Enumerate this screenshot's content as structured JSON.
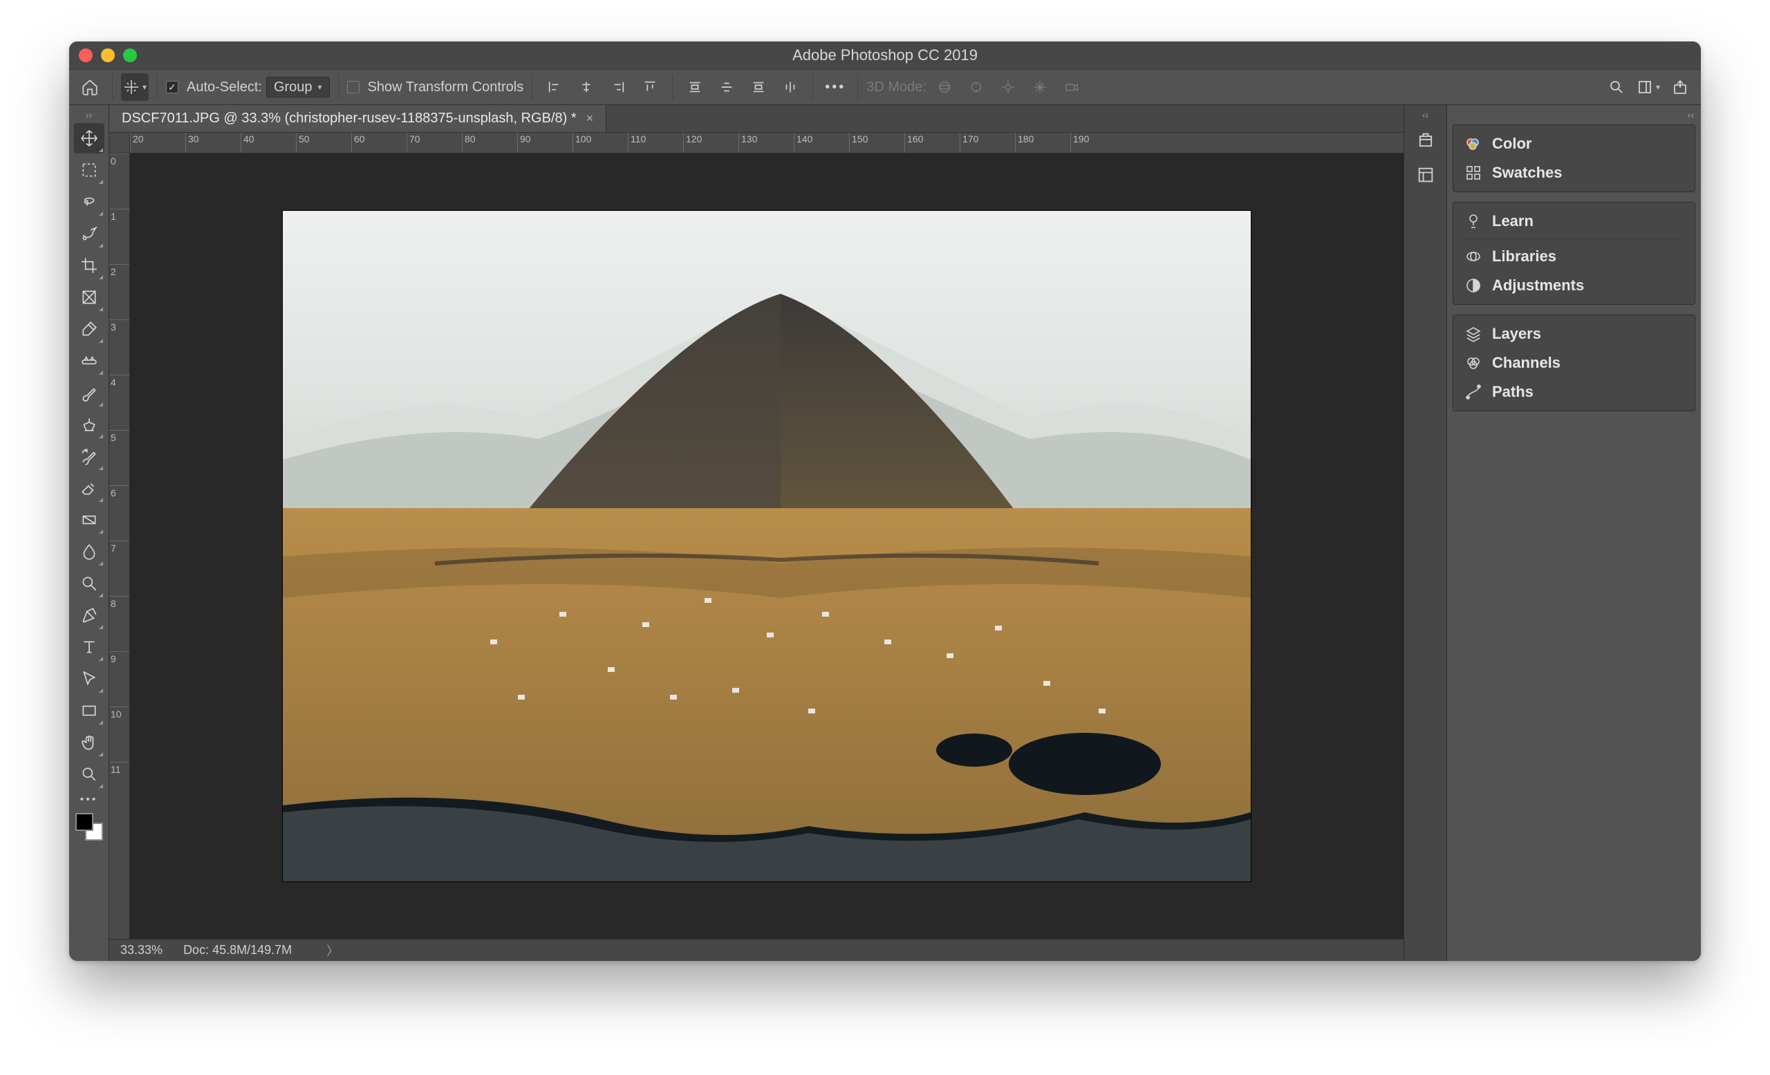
{
  "titlebar": {
    "title": "Adobe Photoshop CC 2019"
  },
  "optionsbar": {
    "auto_select_label": "Auto-Select:",
    "auto_select_checked": true,
    "group_label": "Group",
    "show_transform_label": "Show Transform Controls",
    "show_transform_checked": false,
    "mode3d_label": "3D Mode:"
  },
  "tools": [
    {
      "name": "move-tool",
      "selected": true
    },
    {
      "name": "marquee-tool"
    },
    {
      "name": "lasso-tool"
    },
    {
      "name": "quick-select-tool"
    },
    {
      "name": "crop-tool"
    },
    {
      "name": "frame-tool"
    },
    {
      "name": "eyedropper-tool"
    },
    {
      "name": "healing-brush-tool"
    },
    {
      "name": "brush-tool"
    },
    {
      "name": "clone-stamp-tool"
    },
    {
      "name": "history-brush-tool"
    },
    {
      "name": "eraser-tool"
    },
    {
      "name": "gradient-tool"
    },
    {
      "name": "blur-tool"
    },
    {
      "name": "dodge-tool"
    },
    {
      "name": "pen-tool"
    },
    {
      "name": "type-tool"
    },
    {
      "name": "path-select-tool"
    },
    {
      "name": "rectangle-tool"
    },
    {
      "name": "hand-tool"
    },
    {
      "name": "zoom-tool"
    }
  ],
  "document": {
    "tab_label": "DSCF7011.JPG @ 33.3% (christopher-rusev-1188375-unsplash, RGB/8) *"
  },
  "ruler_h": [
    "20",
    "30",
    "40",
    "50",
    "60",
    "70",
    "80",
    "90",
    "100",
    "110",
    "120",
    "130",
    "140",
    "150",
    "160",
    "170",
    "180",
    "190"
  ],
  "ruler_v": [
    "0",
    "1",
    "2",
    "3",
    "4",
    "5",
    "6",
    "7",
    "8",
    "9",
    "10",
    "11"
  ],
  "statusbar": {
    "zoom": "33.33%",
    "doc_label": "Doc: 45.8M/149.7M"
  },
  "collapsed_strip": [
    {
      "name": "history-panel-icon"
    },
    {
      "name": "properties-panel-icon"
    }
  ],
  "panels": {
    "group1": [
      {
        "icon": "color-icon",
        "label": "Color"
      },
      {
        "icon": "swatches-icon",
        "label": "Swatches"
      }
    ],
    "group2": [
      {
        "icon": "learn-icon",
        "label": "Learn"
      },
      {
        "icon": "libraries-icon",
        "label": "Libraries"
      },
      {
        "icon": "adjustments-icon",
        "label": "Adjustments"
      }
    ],
    "group3": [
      {
        "icon": "layers-icon",
        "label": "Layers"
      },
      {
        "icon": "channels-icon",
        "label": "Channels"
      },
      {
        "icon": "paths-icon",
        "label": "Paths"
      }
    ]
  }
}
